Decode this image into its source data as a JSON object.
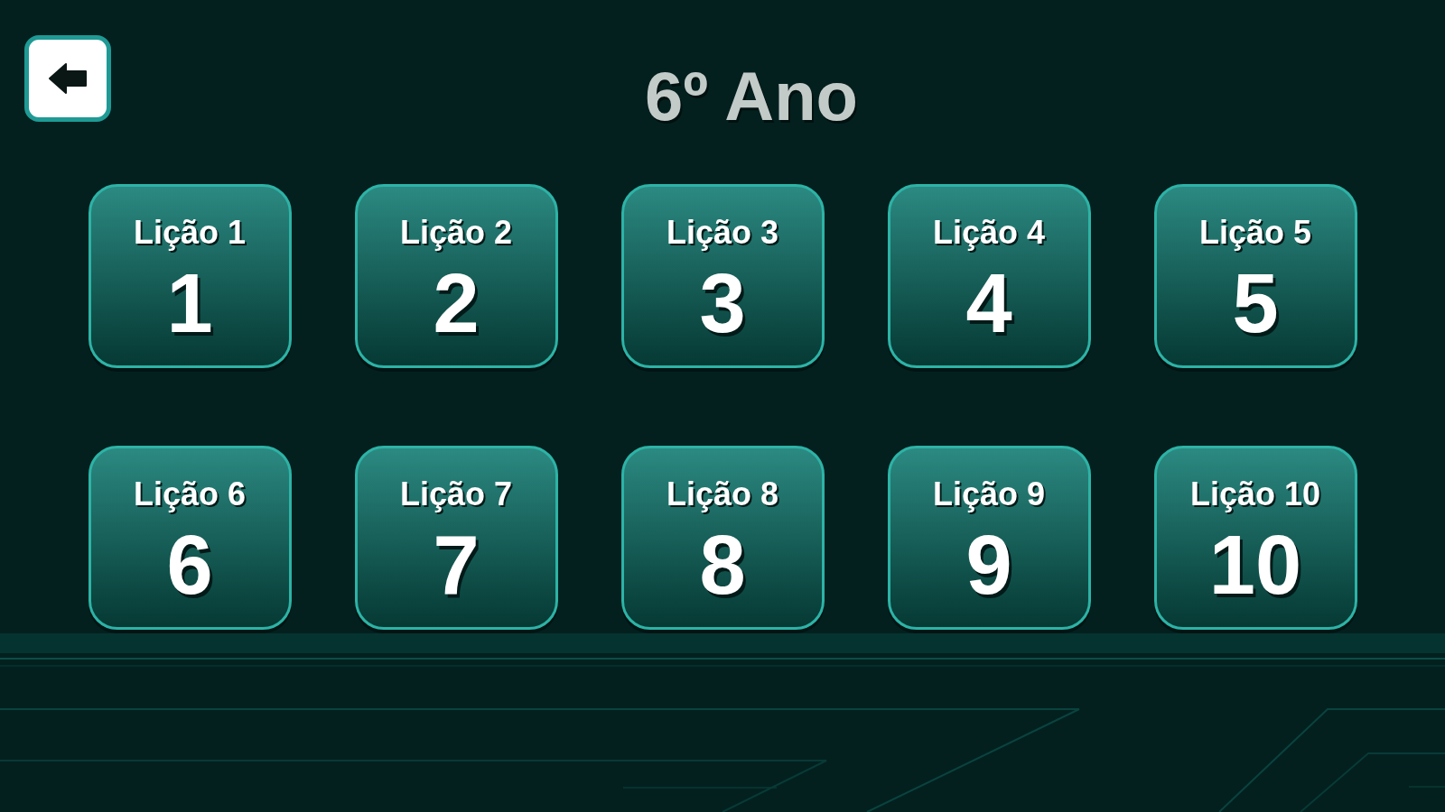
{
  "header": {
    "title": "6º Ano"
  },
  "lessons": [
    {
      "label": "Lição 1",
      "number": "1"
    },
    {
      "label": "Lição 2",
      "number": "2"
    },
    {
      "label": "Lição 3",
      "number": "3"
    },
    {
      "label": "Lição 4",
      "number": "4"
    },
    {
      "label": "Lição 5",
      "number": "5"
    },
    {
      "label": "Lição 6",
      "number": "6"
    },
    {
      "label": "Lição 7",
      "number": "7"
    },
    {
      "label": "Lição 8",
      "number": "8"
    },
    {
      "label": "Lição 9",
      "number": "9"
    },
    {
      "label": "Lição 10",
      "number": "10"
    }
  ]
}
